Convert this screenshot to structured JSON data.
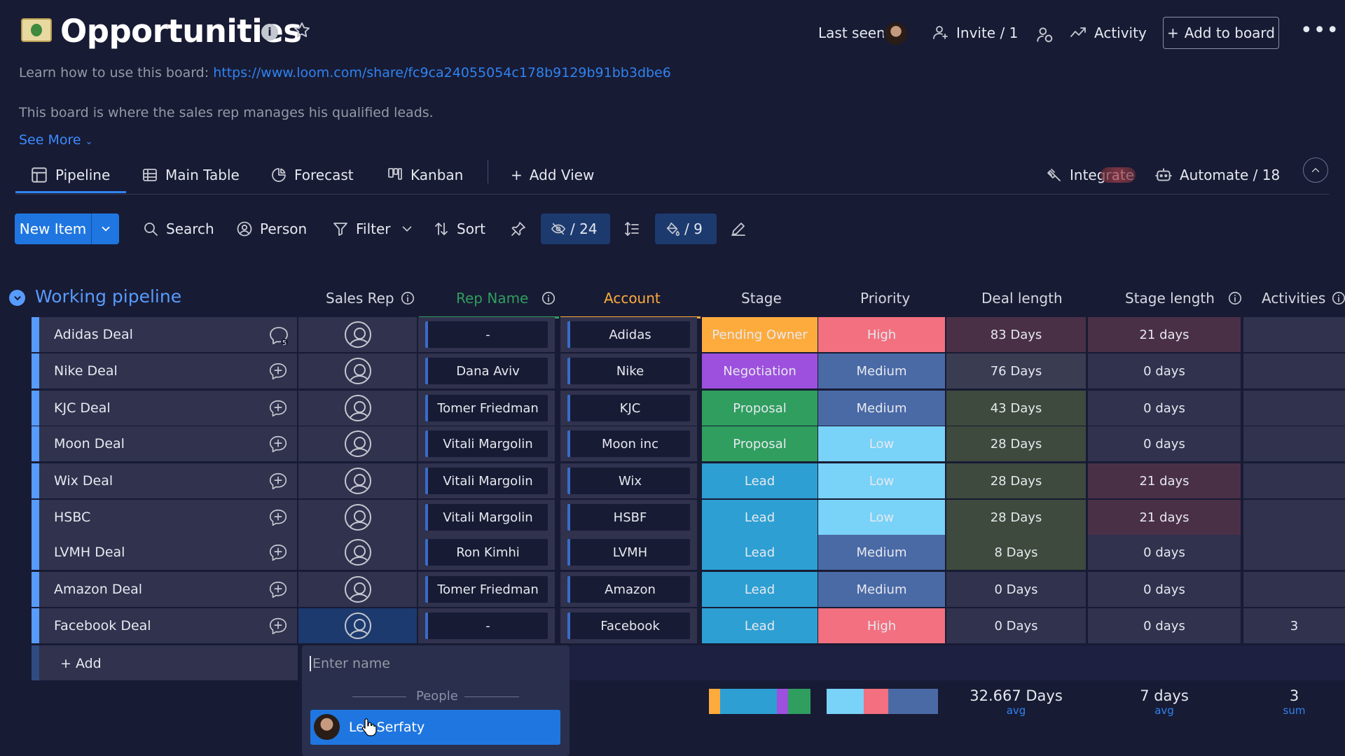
{
  "board": {
    "title": "Opportunities",
    "info_label": "i",
    "learn_prefix": "Learn how to use this board: ",
    "learn_link": "https://www.loom.com/share/fc9ca24055054c178b9129b91bb3dbe6",
    "description": "This board is where the sales rep manages his qualified leads.",
    "see_more": "See More"
  },
  "header": {
    "last_seen": "Last seen",
    "invite": "Invite / 1",
    "activity": "Activity",
    "add_to_board": "Add to board"
  },
  "views": {
    "tabs": [
      {
        "label": "Pipeline",
        "icon": "pipeline-icon",
        "active": true
      },
      {
        "label": "Main Table",
        "icon": "table-icon"
      },
      {
        "label": "Forecast",
        "icon": "forecast-icon"
      },
      {
        "label": "Kanban",
        "icon": "kanban-icon"
      }
    ],
    "add_view": "Add View",
    "integrate": "Integrate",
    "automate": "Automate / 18"
  },
  "toolbar": {
    "new_item": "New Item",
    "search": "Search",
    "person": "Person",
    "filter": "Filter",
    "sort": "Sort",
    "hidden_count": "/ 24",
    "color_count": "/ 9"
  },
  "colors": {
    "accent": "#1f76e0",
    "group": "#579bfc",
    "pending_owner": "#fdab3d",
    "negotiation": "#9d50dd",
    "proposal": "#2f9e5f",
    "lead": "#2d9fd3",
    "high": "#e2445c",
    "medium": "#5559df",
    "low": "#66ccff"
  },
  "group": {
    "title": "Working pipeline",
    "columns": [
      "Sales Rep",
      "Rep Name",
      "Account",
      "Stage",
      "Priority",
      "Deal length",
      "Stage length",
      "Activities"
    ],
    "rows": [
      {
        "name": "Adidas Deal",
        "rep": "-",
        "account": "Adidas",
        "stage": "Pending Owner",
        "priority": "High",
        "deal": "83 Days",
        "stage_len": "21 days",
        "activities": "",
        "updates": "5"
      },
      {
        "name": "Nike Deal",
        "rep": "Dana Aviv",
        "account": "Nike",
        "stage": "Negotiation",
        "priority": "Medium",
        "deal": "76 Days",
        "stage_len": "0 days",
        "activities": "",
        "updates": ""
      },
      {
        "name": "KJC Deal",
        "rep": "Tomer Friedman",
        "account": "KJC",
        "stage": "Proposal",
        "priority": "Medium",
        "deal": "43 Days",
        "stage_len": "0 days",
        "activities": "",
        "updates": ""
      },
      {
        "name": "Moon Deal",
        "rep": "Vitali Margolin",
        "account": "Moon inc",
        "stage": "Proposal",
        "priority": "Low",
        "deal": "28 Days",
        "stage_len": "0 days",
        "activities": "",
        "updates": ""
      },
      {
        "name": "Wix Deal",
        "rep": "Vitali Margolin",
        "account": "Wix",
        "stage": "Lead",
        "priority": "Low",
        "deal": "28 Days",
        "stage_len": "21 days",
        "activities": "",
        "updates": ""
      },
      {
        "name": "HSBC",
        "rep": "Vitali Margolin",
        "account": "HSBF",
        "stage": "Lead",
        "priority": "Low",
        "deal": "28 Days",
        "stage_len": "21 days",
        "activities": "",
        "updates": ""
      },
      {
        "name": "LVMH Deal",
        "rep": "Ron Kimhi",
        "account": "LVMH",
        "stage": "Lead",
        "priority": "Medium",
        "deal": "8 Days",
        "stage_len": "0 days",
        "activities": "",
        "updates": ""
      },
      {
        "name": "Amazon Deal",
        "rep": "Tomer Friedman",
        "account": "Amazon",
        "stage": "Lead",
        "priority": "Medium",
        "deal": "0 Days",
        "stage_len": "0 days",
        "activities": "",
        "updates": ""
      },
      {
        "name": "Facebook Deal",
        "rep": "-",
        "account": "Facebook",
        "stage": "Lead",
        "priority": "High",
        "deal": "0 Days",
        "stage_len": "0 days",
        "activities": "3",
        "updates": ""
      }
    ],
    "add_label": "+ Add"
  },
  "person_dropdown": {
    "placeholder": "Enter name",
    "section": "People",
    "option": "Lea Serfaty"
  },
  "summary": {
    "deal_length": "32.667 Days",
    "deal_unit": "avg",
    "stage_length": "7 days",
    "stage_unit": "avg",
    "activities": "3",
    "activities_unit": "sum"
  }
}
